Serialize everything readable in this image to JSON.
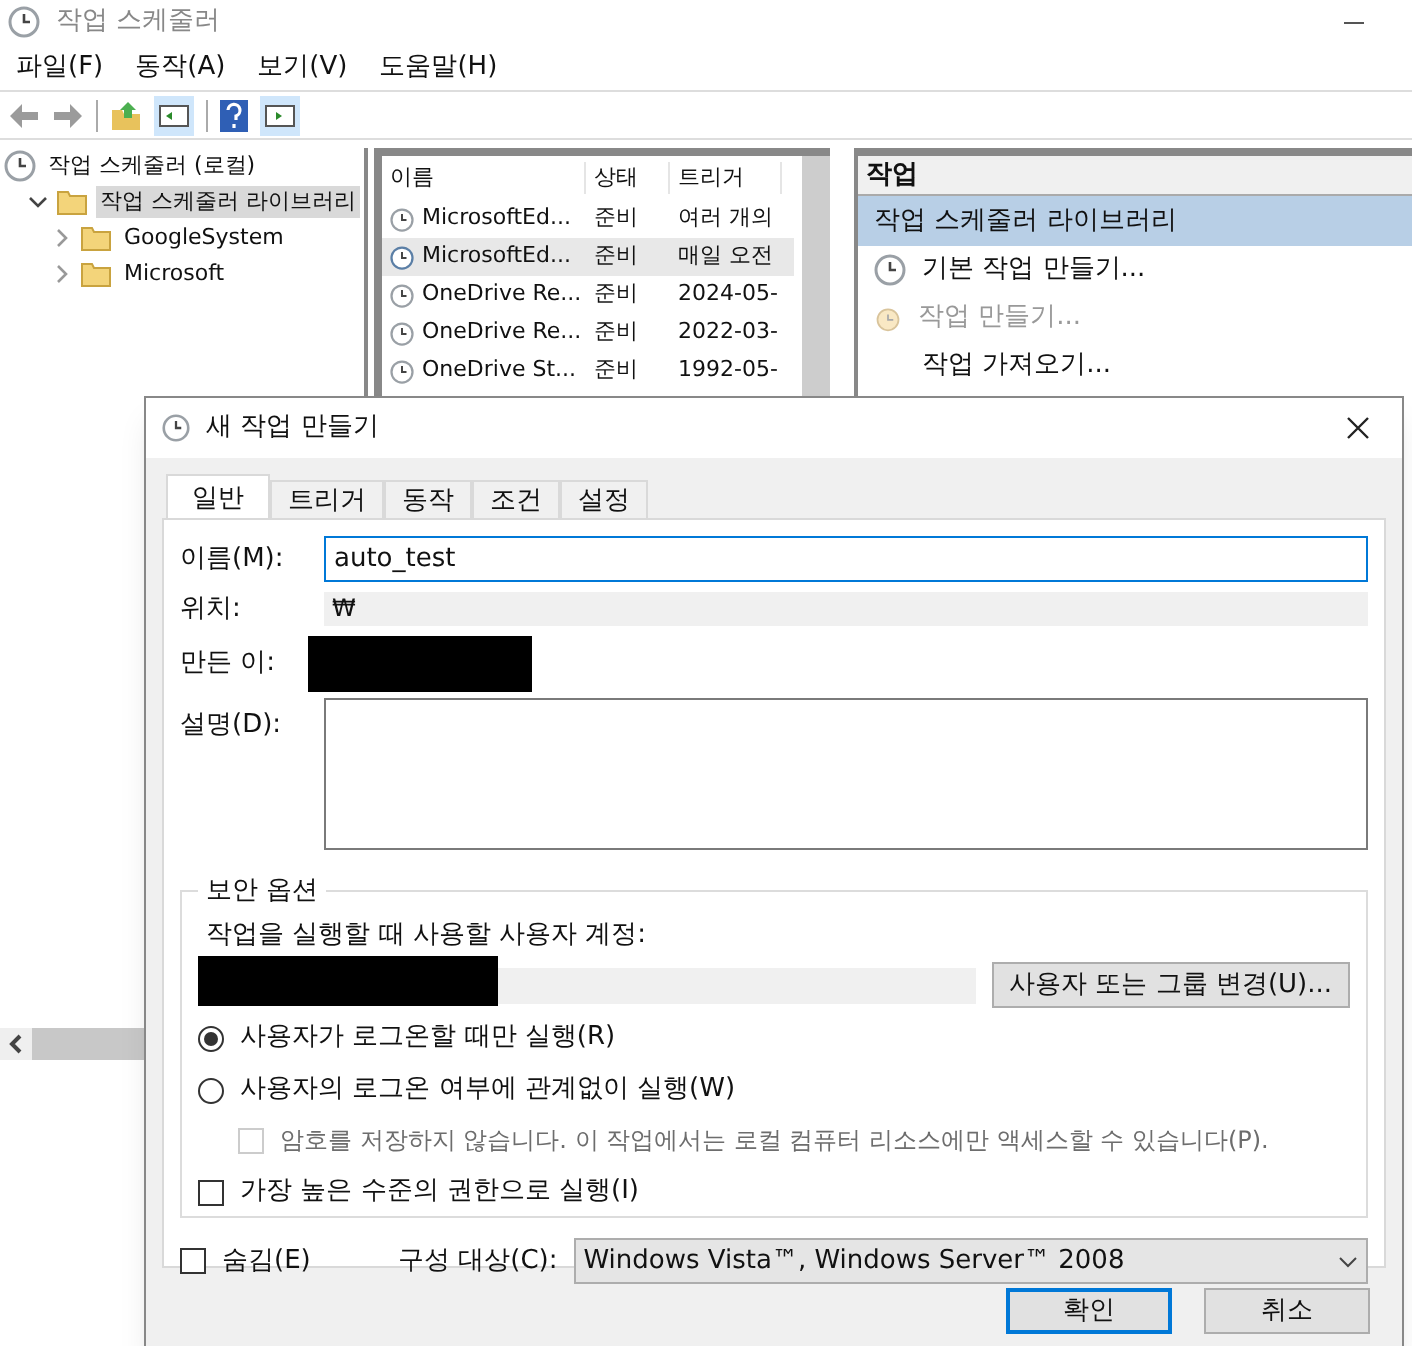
{
  "window": {
    "title": "작업 스케줄러"
  },
  "menu": [
    "파일(F)",
    "동작(A)",
    "보기(V)",
    "도움말(H)"
  ],
  "tree": [
    {
      "label": "작업 스케줄러 (로컬)",
      "selected": false,
      "children": [
        {
          "label": "작업 스케줄러 라이브러리",
          "selected": true,
          "expanded": true,
          "children": [
            {
              "label": "GoogleSystem",
              "selected": false,
              "expanded": false
            },
            {
              "label": "Microsoft",
              "selected": false,
              "expanded": false
            }
          ]
        }
      ]
    }
  ],
  "task_list": {
    "columns": [
      "이름",
      "상태",
      "트리거"
    ],
    "rows": [
      {
        "cells": [
          "MicrosoftEd...",
          "준비",
          "여러 개의"
        ],
        "selected": false
      },
      {
        "cells": [
          "MicrosoftEd...",
          "준비",
          "매일 오전"
        ],
        "selected": true
      },
      {
        "cells": [
          "OneDrive Re...",
          "준비",
          "2024-05-"
        ],
        "selected": false
      },
      {
        "cells": [
          "OneDrive Re...",
          "준비",
          "2022-03-"
        ],
        "selected": false
      },
      {
        "cells": [
          "OneDrive St...",
          "준비",
          "1992-05-"
        ],
        "selected": false
      }
    ]
  },
  "actions": {
    "title": "작업",
    "items": [
      {
        "label": "작업 스케줄러 라이브러리",
        "kind": "section",
        "disabled": false
      },
      {
        "label": "기본 작업 만들기...",
        "kind": "basic-task",
        "disabled": false
      },
      {
        "label": "작업 만들기...",
        "kind": "task",
        "disabled": true
      },
      {
        "label": "작업 가져오기...",
        "kind": "plain",
        "disabled": false
      }
    ]
  },
  "dialog": {
    "title": "새 작업 만들기",
    "tabs": [
      {
        "label": "일반",
        "selected": true
      },
      {
        "label": "트리거",
        "selected": false
      },
      {
        "label": "동작",
        "selected": false
      },
      {
        "label": "조건",
        "selected": false
      },
      {
        "label": "설정",
        "selected": false
      }
    ],
    "name": {
      "label": "이름(M):",
      "value": "auto_test"
    },
    "location": {
      "label": "위치:",
      "value": "₩"
    },
    "author": {
      "label": "만든 이:"
    },
    "description": {
      "label": "설명(D):"
    },
    "security": {
      "title": "보안 옵션",
      "account_label": "작업을 실행할 때 사용할 사용자 계정:",
      "change_button": "사용자 또는 그룹 변경(U)...",
      "run_options": [
        {
          "label": "사용자가 로그온할 때만 실행(R)",
          "selected": true
        },
        {
          "label": "사용자의 로그온 여부에 관계없이 실행(W)",
          "selected": false
        }
      ],
      "no_password": {
        "label": "암호를 저장하지 않습니다. 이 작업에서는 로컬 컴퓨터 리소스에만 액세스할 수 있습니다(P).",
        "checked": false,
        "disabled": true
      },
      "highest": {
        "label": "가장 높은 수준의 권한으로 실행(I)",
        "checked": false
      }
    },
    "hidden": {
      "label": "숨김(E)",
      "checked": false
    },
    "configure": {
      "label": "구성 대상(C):",
      "value": "Windows Vista™, Windows Server™ 2008"
    },
    "buttons": [
      "확인",
      "취소"
    ]
  }
}
